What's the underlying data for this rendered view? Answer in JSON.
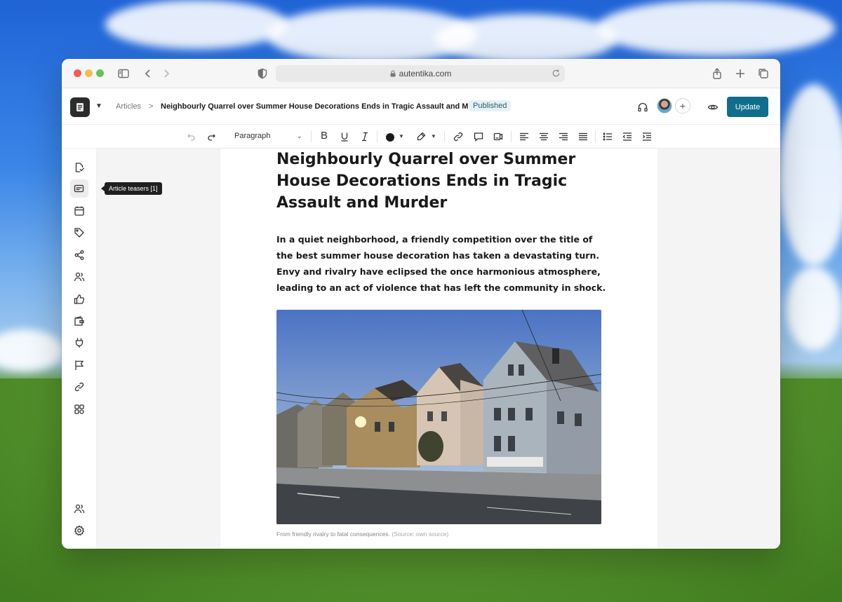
{
  "browser": {
    "url": "autentika.com"
  },
  "header": {
    "breadcrumb_root": "Articles",
    "breadcrumb_separator": ">",
    "article_title": "Neighbourly Quarrel over Summer House Decorations Ends in Tragic Assault and Murder",
    "status": "Published",
    "update_label": "Update",
    "accent_color": "#0f6e8c"
  },
  "toolbar": {
    "block_style": "Paragraph",
    "text_color": "#1a1a1a"
  },
  "sidebar": {
    "tooltip": "Article teasers [1]",
    "items": [
      "document-check-icon",
      "article-teasers-icon",
      "calendar-icon",
      "tag-icon",
      "share-icon",
      "users-icon",
      "thumbs-up-icon",
      "wallet-icon",
      "plug-icon",
      "flag-icon",
      "link-icon",
      "apps-icon",
      "team-icon",
      "settings-icon"
    ]
  },
  "article": {
    "headline": "Neighbourly Quarrel over Summer House Decorations Ends in Tragic Assault and Murder",
    "lead": "In a quiet neighborhood, a friendly competition over the title of the best summer house decoration has taken a devastating turn. Envy and rivalry have eclipsed the once harmonious atmosphere, leading to an act of violence that has left the community in shock.",
    "caption": "From friendly rivalry to fatal consequences.",
    "caption_source": "(Source: own source)"
  }
}
